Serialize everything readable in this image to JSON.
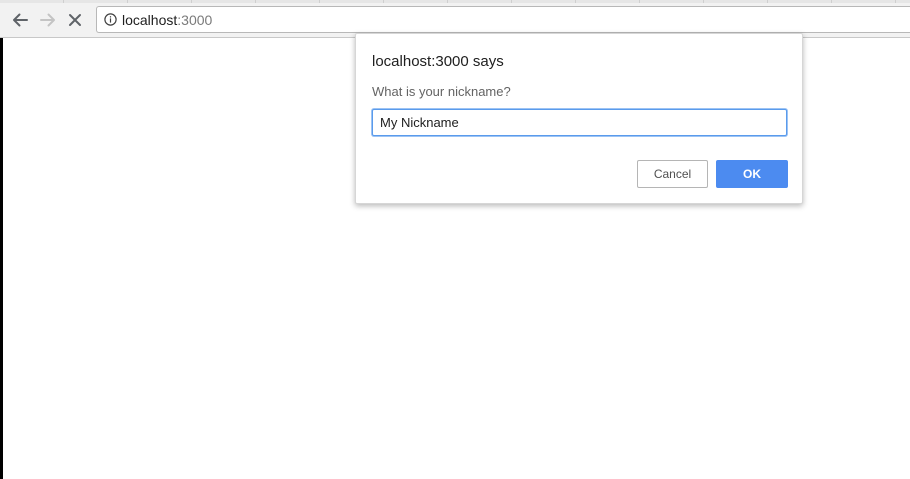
{
  "browser": {
    "url_host": "localhost",
    "url_port": ":3000",
    "icons": {
      "back": "arrow-left-icon",
      "forward": "arrow-right-icon",
      "stop": "close-icon",
      "info": "info-icon"
    }
  },
  "dialog": {
    "title": "localhost:3000 says",
    "message": "What is your nickname?",
    "input_value": "My Nickname",
    "cancel_label": "Cancel",
    "ok_label": "OK",
    "colors": {
      "ok_button": "#4c8bf0",
      "input_focus_border": "#5a9bec"
    }
  }
}
